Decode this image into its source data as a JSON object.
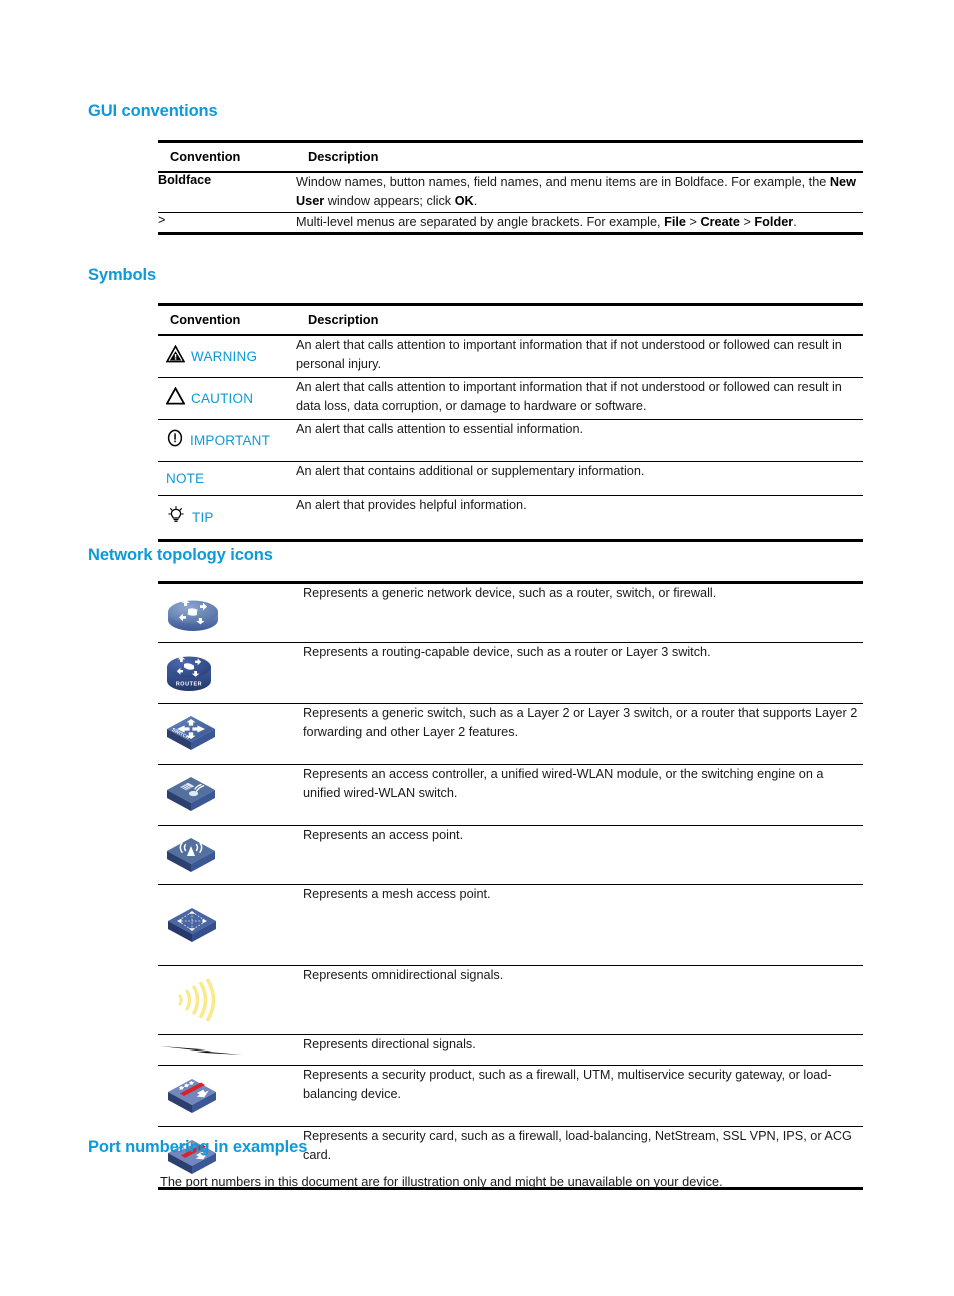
{
  "colors": {
    "heading_blue": "#0c9ad9",
    "symbol_blue": "#0c9ad9",
    "rule_black": "#000000",
    "icon_blue_dark": "#2c4a8c",
    "icon_blue_mid": "#4a6bb0",
    "icon_blue_light": "#7e96c8",
    "signal_yellow": "#fbe98a",
    "security_red": "#d8232a"
  },
  "sections": {
    "gui_conventions": {
      "heading": "GUI conventions",
      "table": {
        "headers": [
          "Convention",
          "Description"
        ],
        "rows": [
          {
            "convention": "Boldface",
            "bold_convention": true,
            "description_html": "Window names, button names, field names, and menu items are in Boldface. For example, the <b>New User</b> window appears; click <b>OK</b>."
          },
          {
            "convention": ">",
            "bold_convention": false,
            "description_html": "Multi-level menus are separated by angle brackets. For example, <b>File</b> &gt; <b>Create</b> &gt; <b>Folder</b>."
          }
        ]
      }
    },
    "symbols": {
      "heading": "Symbols",
      "table": {
        "headers": [
          "Convention",
          "Description"
        ],
        "rows": [
          {
            "icon": "warning-triangle-icon",
            "label": "WARNING",
            "description": "An alert that calls attention to important information that if not understood or followed can result in personal injury."
          },
          {
            "icon": "caution-triangle-icon",
            "label": "CAUTION",
            "description": "An alert that calls attention to important information that if not understood or followed can result in data loss, data corruption, or damage to hardware or software."
          },
          {
            "icon": "important-circle-icon",
            "label": "IMPORTANT",
            "description": "An alert that calls attention to essential information."
          },
          {
            "icon": "none",
            "label": "NOTE",
            "description": "An alert that contains additional or supplementary information."
          },
          {
            "icon": "tip-bulb-icon",
            "label": "TIP",
            "description": "An alert that provides helpful information."
          }
        ]
      }
    },
    "network_topology": {
      "heading": "Network topology icons",
      "rows": [
        {
          "icon": "generic-network-device-icon",
          "description": "Represents a generic network device, such as a router, switch, or firewall."
        },
        {
          "icon": "router-icon",
          "icon_text": "ROUTER",
          "description": "Represents a routing-capable device, such as a router or Layer 3 switch."
        },
        {
          "icon": "switch-icon",
          "icon_text": "SWITCH",
          "description": "Represents a generic switch, such as a Layer 2 or Layer 3 switch, or a router that supports Layer 2 forwarding and other Layer 2 features."
        },
        {
          "icon": "access-controller-icon",
          "description": "Represents an access controller, a unified wired-WLAN module, or the switching engine on a unified wired-WLAN switch."
        },
        {
          "icon": "access-point-icon",
          "description": "Represents an access point."
        },
        {
          "icon": "mesh-access-point-icon",
          "description": "Represents a mesh access point."
        },
        {
          "icon": "omnidirectional-signal-icon",
          "description": "Represents omnidirectional signals."
        },
        {
          "icon": "directional-signal-icon",
          "description": "Represents directional signals."
        },
        {
          "icon": "security-product-icon",
          "description": "Represents a security product, such as a firewall, UTM, multiservice security gateway, or load-balancing device."
        },
        {
          "icon": "security-card-icon",
          "description": "Represents a security card, such as a firewall, load-balancing, NetStream, SSL VPN, IPS, or ACG card."
        }
      ]
    },
    "port_numbering": {
      "heading": "Port numbering in examples",
      "paragraph": "The port numbers in this document are for illustration only and might be unavailable on your device."
    }
  }
}
